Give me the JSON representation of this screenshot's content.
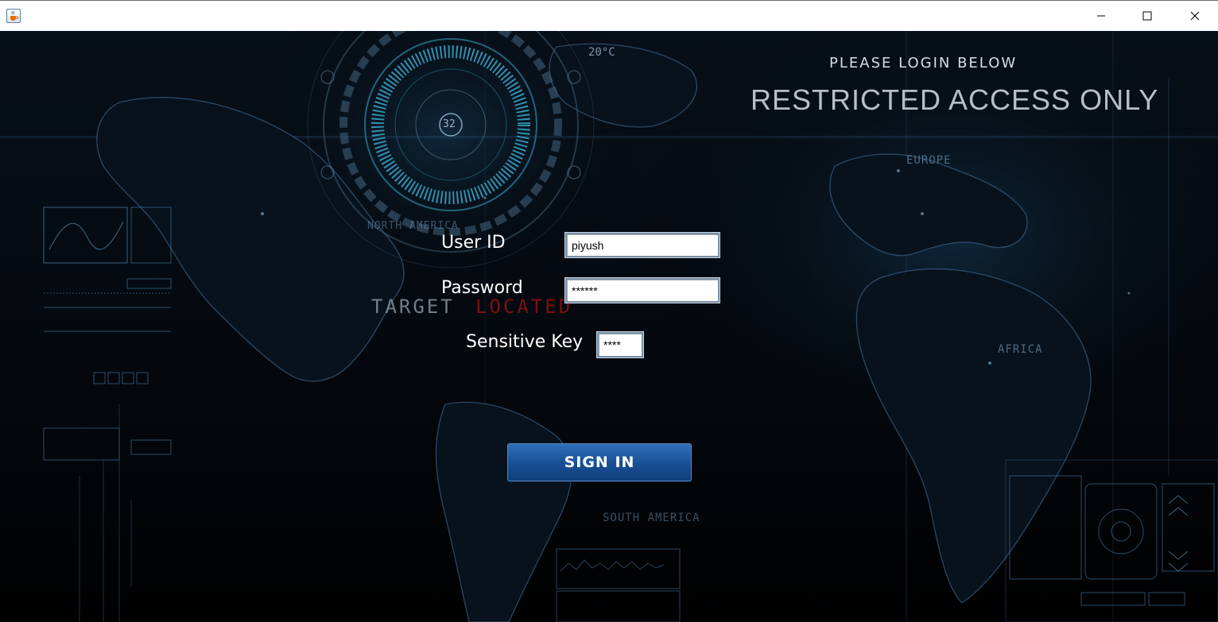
{
  "window": {
    "app_icon": "java-cup-icon",
    "controls": {
      "minimize": "—",
      "maximize": "☐",
      "close": "✕"
    }
  },
  "header": {
    "subtitle": "PLEASE LOGIN BELOW",
    "title": "RESTRICTED ACCESS ONLY"
  },
  "form": {
    "user_id_label": "User ID",
    "user_id_value": "piyush",
    "password_label": "Password",
    "password_value": "******",
    "sensitive_key_label": "Sensitive Key",
    "sensitive_key_value": "****",
    "signin_label": "SIGN IN"
  },
  "background_text": {
    "target": "TARGET",
    "located": "LOCATED",
    "temperature": "20°C",
    "dial_number": "32",
    "north_america": "NORTH AMERICA",
    "south_america": "SOUTH AMERICA",
    "europe": "EUROPE",
    "africa": "AFRICA"
  },
  "colors": {
    "accent_blue": "#184f94",
    "hud_cyan": "#3aa6c9",
    "map_blue": "#5a8fc4"
  }
}
